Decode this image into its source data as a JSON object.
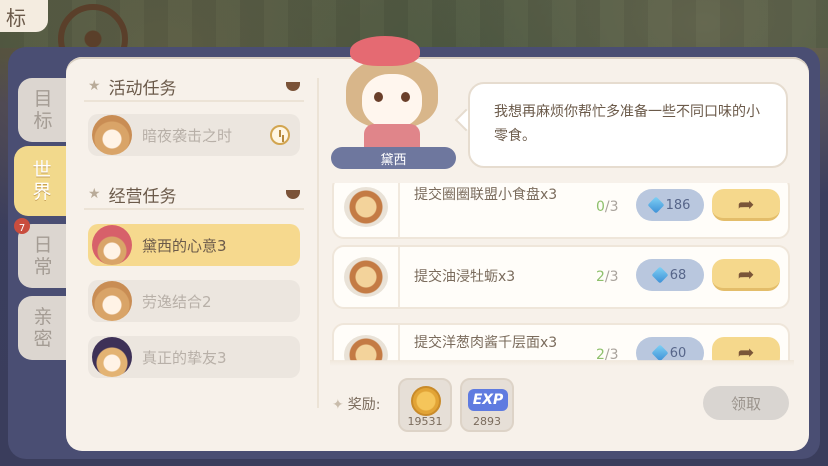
{
  "top_corner": {
    "label": "标"
  },
  "side_tabs": [
    {
      "label": "目标",
      "active": false
    },
    {
      "label": "世界",
      "active": true
    },
    {
      "label": "日常",
      "active": false,
      "badge": "7"
    },
    {
      "label": "亲密",
      "active": false
    }
  ],
  "sections": {
    "event": {
      "title": "活动任务"
    },
    "business": {
      "title": "经营任务"
    }
  },
  "quests": {
    "event_items": [
      {
        "label": "暗夜袭击之时",
        "icon": "clock-icon"
      }
    ],
    "business_items": [
      {
        "label": "黛西的心意3",
        "selected": true
      },
      {
        "label": "劳逸结合2",
        "selected": false
      },
      {
        "label": "真正的挚友3",
        "selected": false
      }
    ]
  },
  "character": {
    "name": "黛西",
    "dialogue": "我想再麻烦你帮忙多准备一些不同口味的小零食。"
  },
  "tasks": [
    {
      "name": "提交圈圈联盟小食盘x3",
      "done": "0",
      "total": "/3",
      "reward": "186",
      "icon": "gem-icon"
    },
    {
      "name": "提交油浸牡蛎x3",
      "done": "2",
      "total": "/3",
      "reward": "68",
      "icon": "gem-icon"
    },
    {
      "name": "提交洋葱肉酱千层面x3",
      "done": "2",
      "total": "/3",
      "reward": "60",
      "icon": "gem-icon"
    }
  ],
  "rewards": {
    "label": "奖励:",
    "items": [
      {
        "icon": "coin-icon",
        "count": "19531"
      },
      {
        "icon": "exp-icon",
        "text": "EXP",
        "count": "2893"
      }
    ]
  },
  "claim_button": {
    "label": "领取"
  },
  "colors": {
    "panel_bg": "#f7f1ea",
    "frame": "#4a4e73",
    "selected": "#f6d98e",
    "progress_done": "#8ec06c",
    "go_button": "#f5d88c"
  }
}
